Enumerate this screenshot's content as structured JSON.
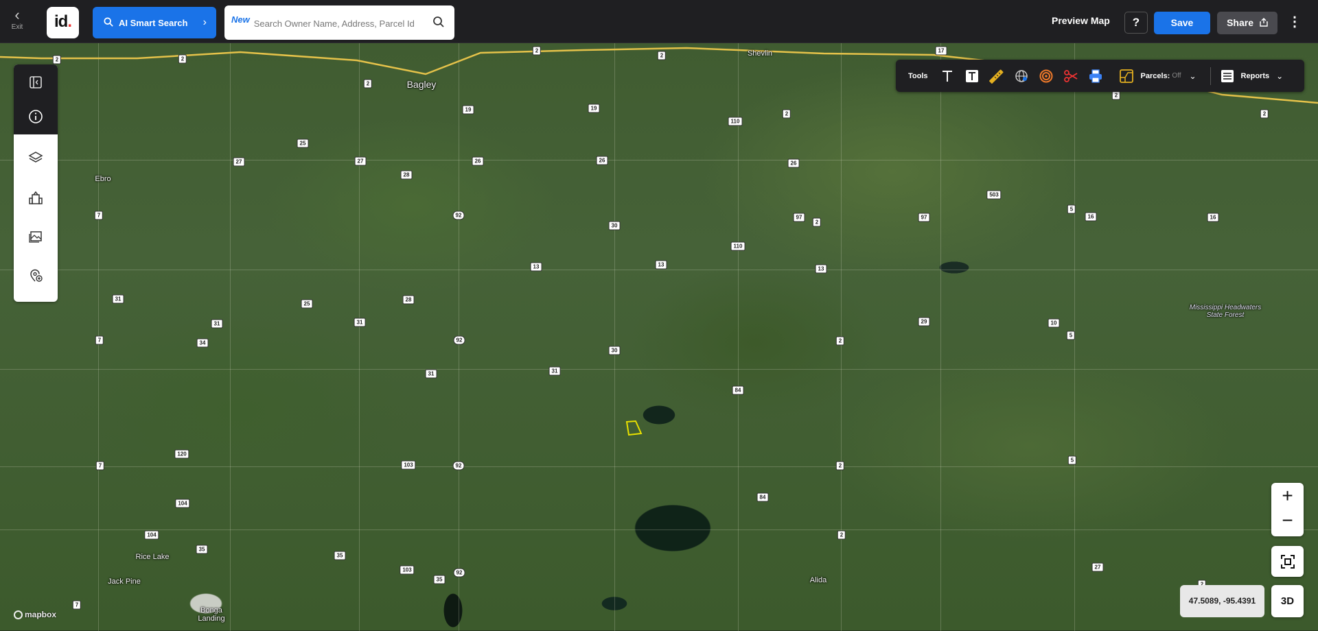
{
  "topbar": {
    "exit_label": "Exit",
    "logo_text": "id",
    "logo_dot": ".",
    "ai_search_label": "AI Smart Search",
    "search_new_badge": "New",
    "search_placeholder": "Search Owner Name, Address, Parcel Id",
    "preview_map_label": "Preview Map",
    "help_label": "?",
    "save_label": "Save",
    "share_label": "Share",
    "more_label": "⋮"
  },
  "tools_bar": {
    "label": "Tools",
    "icons": [
      "text-icon",
      "text-box-icon",
      "ruler-icon",
      "globe-icon",
      "target-icon",
      "scissors-icon",
      "print-icon"
    ],
    "parcels_label": "Parcels:",
    "parcels_value": "Off",
    "reports_label": "Reports"
  },
  "left_tools": [
    "sidebar-toggle-icon",
    "info-icon",
    "layers-icon",
    "buildings-icon",
    "imagery-icon",
    "add-location-icon"
  ],
  "map": {
    "places": [
      {
        "name": "Bagley",
        "big": true
      },
      {
        "name": "Shevlin"
      },
      {
        "name": "Ebro"
      },
      {
        "name": "Rice Lake"
      },
      {
        "name": "Jack Pine"
      },
      {
        "name": "Bonga\nLanding"
      },
      {
        "name": "Alida"
      },
      {
        "name": "Mississippi Headwaters\nState Forest",
        "forest": true
      }
    ],
    "shields": [
      "2",
      "2",
      "2",
      "2",
      "2",
      "2",
      "2",
      "2",
      "2",
      "2",
      "2",
      "2",
      "2",
      "17",
      "19",
      "19",
      "25",
      "27",
      "27",
      "26",
      "26",
      "26",
      "28",
      "92",
      "92",
      "92",
      "92",
      "30",
      "30",
      "110",
      "110",
      "503",
      "5",
      "5",
      "5",
      "16",
      "16",
      "7",
      "7",
      "7",
      "7",
      "31",
      "31",
      "31",
      "31",
      "31",
      "25",
      "28",
      "13",
      "13",
      "13",
      "97",
      "97",
      "29",
      "10",
      "34",
      "84",
      "84",
      "103",
      "103",
      "120",
      "104",
      "104",
      "35",
      "35",
      "35",
      "27"
    ]
  },
  "coords": "47.5089, -95.4391",
  "zoom": {
    "in": "+",
    "out": "−"
  },
  "threed_label": "3D",
  "attribution": "mapbox",
  "colors": {
    "accent": "#1a73e8",
    "topbar_bg": "#1f1f22",
    "highway": "#e5c24a",
    "parcel_outline": "#e8e000"
  }
}
